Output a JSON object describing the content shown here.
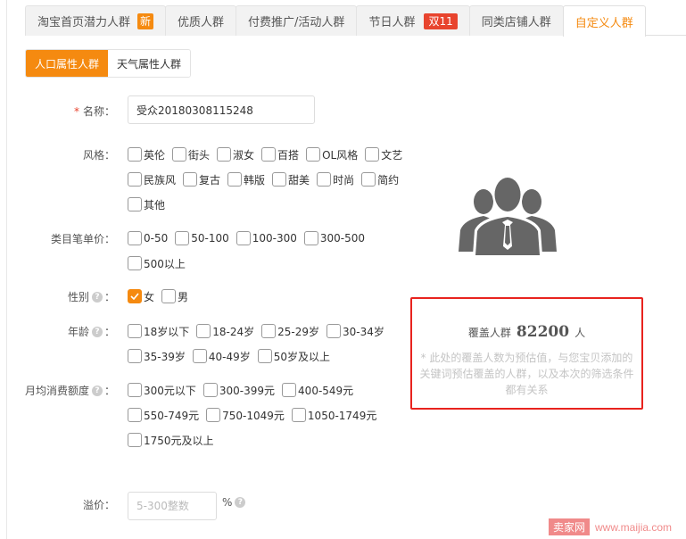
{
  "tabs": [
    {
      "label": "淘宝首页潜力人群",
      "badge": "新",
      "active": false
    },
    {
      "label": "优质人群",
      "badge": null,
      "active": false
    },
    {
      "label": "付费推广/活动人群",
      "badge": null,
      "active": false
    },
    {
      "label": "节日人群",
      "badge": "双11",
      "active": false
    },
    {
      "label": "同类店铺人群",
      "badge": null,
      "active": false
    },
    {
      "label": "自定义人群",
      "badge": null,
      "active": true
    }
  ],
  "subtabs": [
    {
      "label": "人口属性人群",
      "active": true
    },
    {
      "label": "天气属性人群",
      "active": false
    }
  ],
  "form": {
    "name": {
      "required_mark": "*",
      "label": "名称：",
      "value": "受众20180308115248"
    },
    "style": {
      "label": "风格：",
      "options": [
        "英伦",
        "街头",
        "淑女",
        "百搭",
        "OL风格",
        "文艺",
        "民族风",
        "复古",
        "韩版",
        "甜美",
        "时尚",
        "简约",
        "其他"
      ]
    },
    "price": {
      "label": "类目笔单价：",
      "options": [
        "0-50",
        "50-100",
        "100-300",
        "300-500",
        "500以上"
      ]
    },
    "gender": {
      "label": "性别",
      "colon": "：",
      "options": [
        {
          "label": "女",
          "checked": true
        },
        {
          "label": "男",
          "checked": false
        }
      ]
    },
    "age": {
      "label": "年龄",
      "colon": "：",
      "options": [
        "18岁以下",
        "18-24岁",
        "25-29岁",
        "30-34岁",
        "35-39岁",
        "40-49岁",
        "50岁及以上"
      ]
    },
    "spend": {
      "label": "月均消费额度",
      "colon": "：",
      "options": [
        "300元以下",
        "300-399元",
        "400-549元",
        "550-749元",
        "750-1049元",
        "1050-1749元",
        "1750元及以上"
      ]
    },
    "premium": {
      "label": "溢价：",
      "placeholder": "5-300整数",
      "value": "",
      "unit": "%"
    }
  },
  "coverage": {
    "prefix": "覆盖人群",
    "count": "82200",
    "suffix": "人",
    "note": "* 此处的覆盖人数为预估值，与您宝贝添加的关键词预估覆盖的人群，以及本次的筛选条件都有关系"
  },
  "watermark": {
    "brand": "卖家网",
    "url": "www.maijia.com"
  },
  "colors": {
    "accent": "#f58a10",
    "badge_red": "#e8442e",
    "highlight_border": "#e8231e"
  }
}
